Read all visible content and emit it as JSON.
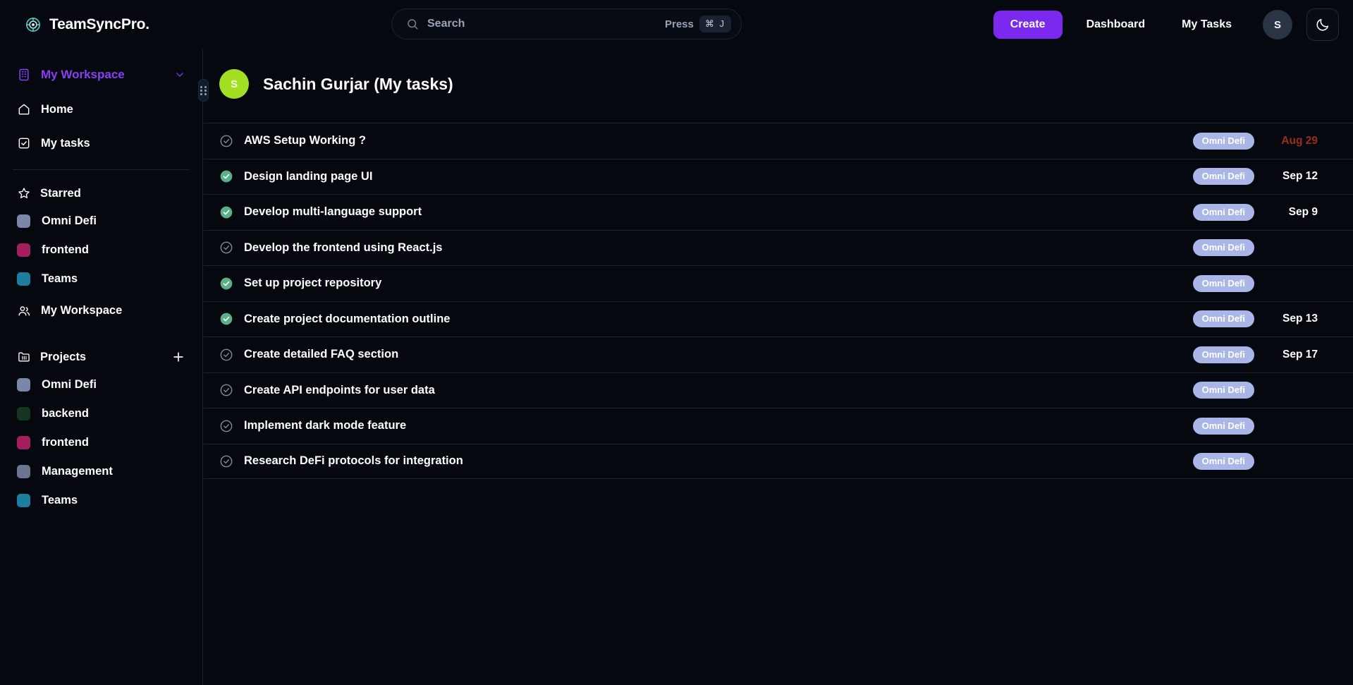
{
  "app": {
    "brand": "TeamSyncPro.",
    "logo_icon": "target-circle-icon"
  },
  "colors": {
    "background": "#05080f",
    "accent_purple": "#7b29ef",
    "workspace_purple": "#8b3ff5",
    "badge": "#aab6e8",
    "overdue_red": "#9c2b20",
    "avatar_green": "#a3e023",
    "check_green": "#5cb089"
  },
  "search": {
    "placeholder": "Search",
    "value": "",
    "press_label": "Press",
    "shortcut": "⌘ J",
    "icon": "search-icon"
  },
  "topnav": {
    "create_label": "Create",
    "dashboard_label": "Dashboard",
    "mytasks_label": "My Tasks",
    "avatar_initial": "S",
    "theme_icon": "moon-icon"
  },
  "sidebar": {
    "workspace": {
      "label": "My Workspace",
      "icon": "building-icon",
      "chevron": "chevron-down-icon"
    },
    "nav": [
      {
        "label": "Home",
        "icon": "home-icon"
      },
      {
        "label": "My tasks",
        "icon": "checkbox-icon"
      }
    ],
    "starred": {
      "label": "Starred",
      "icon": "star-icon",
      "items": [
        {
          "label": "Omni Defi",
          "color": "#7b86a8"
        },
        {
          "label": "frontend",
          "color": "#a51f5e"
        },
        {
          "label": "Teams",
          "color": "#1d7fa0"
        }
      ],
      "workspace_entry": {
        "label": "My Workspace",
        "icon": "users-icon"
      }
    },
    "projects": {
      "label": "Projects",
      "icon": "folder-icon",
      "add_icon": "plus-icon",
      "items": [
        {
          "label": "Omni Defi",
          "color": "#7b86a8"
        },
        {
          "label": "backend",
          "color": "#14351f"
        },
        {
          "label": "frontend",
          "color": "#a51f5e"
        },
        {
          "label": "Management",
          "color": "#6b7590"
        },
        {
          "label": "Teams",
          "color": "#1d7fa0"
        }
      ]
    },
    "resize_handle": "drag-handle-icon"
  },
  "main": {
    "avatar_initial": "S",
    "title": "Sachin Gurjar (My tasks)",
    "tasks": [
      {
        "title": "AWS Setup Working ?",
        "done": false,
        "project": "Omni Defi",
        "due": "Aug 29",
        "overdue": true
      },
      {
        "title": "Design landing page UI",
        "done": true,
        "project": "Omni Defi",
        "due": "Sep 12",
        "overdue": false
      },
      {
        "title": "Develop multi-language support",
        "done": true,
        "project": "Omni Defi",
        "due": "Sep 9",
        "overdue": false
      },
      {
        "title": "Develop the frontend using React.js",
        "done": false,
        "project": "Omni Defi",
        "due": "",
        "overdue": false
      },
      {
        "title": "Set up project repository",
        "done": true,
        "project": "Omni Defi",
        "due": "",
        "overdue": false
      },
      {
        "title": "Create project documentation outline",
        "done": true,
        "project": "Omni Defi",
        "due": "Sep 13",
        "overdue": false
      },
      {
        "title": "Create detailed FAQ section",
        "done": false,
        "project": "Omni Defi",
        "due": "Sep 17",
        "overdue": false
      },
      {
        "title": "Create API endpoints for user data",
        "done": false,
        "project": "Omni Defi",
        "due": "",
        "overdue": false
      },
      {
        "title": "Implement dark mode feature",
        "done": false,
        "project": "Omni Defi",
        "due": "",
        "overdue": false
      },
      {
        "title": "Research DeFi protocols for integration",
        "done": false,
        "project": "Omni Defi",
        "due": "",
        "overdue": false
      }
    ]
  }
}
